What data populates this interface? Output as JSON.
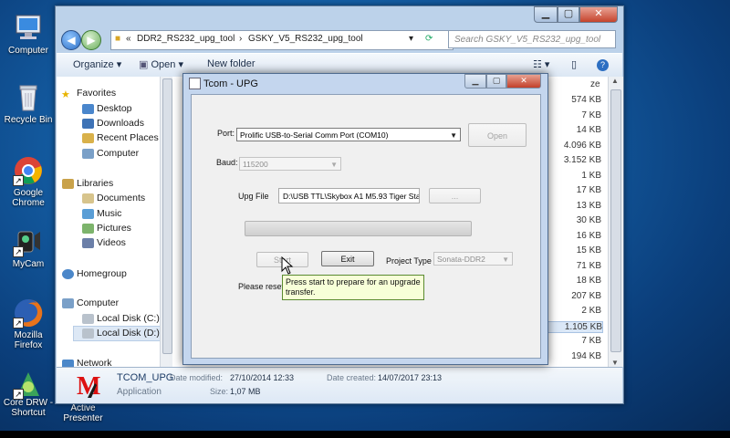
{
  "desktop": {
    "icons": [
      {
        "label": "Computer",
        "icon": "computer-icon"
      },
      {
        "label": "Recycle Bin",
        "icon": "recycle-bin-icon"
      },
      {
        "label": "Google Chrome",
        "icon": "chrome-icon"
      },
      {
        "label": "MyCam",
        "icon": "mycam-icon"
      },
      {
        "label": "Mozilla Firefox",
        "icon": "firefox-icon"
      },
      {
        "label": "Core DRW - Shortcut",
        "icon": "coreldraw-icon"
      },
      {
        "label": "Active Presenter",
        "icon": "active-presenter-icon"
      }
    ]
  },
  "explorer": {
    "breadcrumb": [
      "DDR2_RS232_upg_tool",
      "GSKY_V5_RS232_upg_tool"
    ],
    "search_placeholder": "Search GSKY_V5_RS232_upg_tool",
    "toolbar": {
      "organize": "Organize",
      "open": "Open",
      "new_folder": "New folder"
    },
    "nav": {
      "favorites": "Favorites",
      "favorites_items": [
        "Desktop",
        "Downloads",
        "Recent Places",
        "Computer"
      ],
      "libraries": "Libraries",
      "libraries_items": [
        "Documents",
        "Music",
        "Pictures",
        "Videos"
      ],
      "homegroup": "Homegroup",
      "computer": "Computer",
      "computer_items": [
        "Local Disk (C:)",
        "Local Disk (D:)"
      ],
      "network": "Network"
    },
    "size_header": "ze",
    "sizes": [
      "574 KB",
      "7 KB",
      "14 KB",
      "4.096 KB",
      "3.152 KB",
      "1 KB",
      "17 KB",
      "13 KB",
      "30 KB",
      "16 KB",
      "15 KB",
      "71 KB",
      "18 KB",
      "207 KB",
      "2 KB",
      "1.105 KB",
      "7 KB",
      "194 KB"
    ],
    "details": {
      "name": "TCOM_UPG",
      "type": "Application",
      "modified_label": "Date modified:",
      "modified_value": "27/10/2014 12:33",
      "created_label": "Date created:",
      "created_value": "14/07/2017 23:13",
      "size_label": "Size:",
      "size_value": "1,07 MB"
    }
  },
  "dialog": {
    "title": "Tcom - UPG",
    "port_label": "Port:",
    "port_value": "Prolific USB-to-Serial Comm Port (COM10)",
    "open_button": "Open",
    "baud_label": "Baud:",
    "baud_value": "115200",
    "upg_label": "Upg File",
    "upg_path": "D:\\USB TTL\\Skybox A1 M5.93 Tiger Sta",
    "browse_button": "...",
    "progress": 0,
    "start_button": "Start",
    "exit_button": "Exit",
    "project_type_label": "Project Type",
    "project_type_value": "Sonata-DDR2",
    "status_text": "Please reset",
    "tooltip": "Press start to prepare for an upgrade transfer."
  }
}
